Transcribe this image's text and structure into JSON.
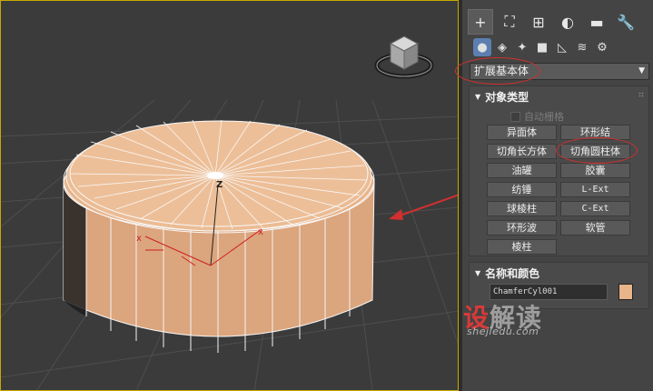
{
  "viewport": {
    "axis_label": "Z",
    "accent_outline": "#c8a800",
    "object_color": "#e8b48a"
  },
  "panel": {
    "top_tabs": [
      {
        "icon": "plus-icon",
        "glyph": "+",
        "active": true
      },
      {
        "icon": "modify-icon",
        "glyph": "⛶"
      },
      {
        "icon": "hierarchy-icon",
        "glyph": "⊞"
      },
      {
        "icon": "motion-icon",
        "glyph": "◐"
      },
      {
        "icon": "display-icon",
        "glyph": "▬"
      },
      {
        "icon": "utilities-icon",
        "glyph": "🔧"
      }
    ],
    "sub_tabs": [
      {
        "icon": "geometry-icon",
        "glyph": "●",
        "active": true
      },
      {
        "icon": "shapes-icon",
        "glyph": "◈"
      },
      {
        "icon": "lights-icon",
        "glyph": "✦"
      },
      {
        "icon": "camera-icon",
        "glyph": "■"
      },
      {
        "icon": "helpers-icon",
        "glyph": "◺"
      },
      {
        "icon": "spacewarps-icon",
        "glyph": "≋"
      },
      {
        "icon": "systems-icon",
        "glyph": "⚙"
      }
    ],
    "category_dropdown": "扩展基本体",
    "object_type": {
      "title": "对象类型",
      "autogrid_label": "自动栅格",
      "buttons": [
        [
          "异面体",
          "环形结"
        ],
        [
          "切角长方体",
          "切角圆柱体"
        ],
        [
          "油罐",
          "胶囊"
        ],
        [
          "纺锤",
          "L-Ext"
        ],
        [
          "球棱柱",
          "C-Ext"
        ],
        [
          "环形波",
          "软管"
        ],
        [
          "棱柱"
        ]
      ]
    },
    "name_color": {
      "title": "名称和颜色",
      "name_value": "ChamferCyl001",
      "swatch_color": "#e8b48a"
    }
  },
  "watermark": {
    "logo_text_1": "设",
    "logo_text_2": "解读",
    "url": "shejiedu.com"
  },
  "colors": {
    "highlight_red": "#d03030"
  }
}
